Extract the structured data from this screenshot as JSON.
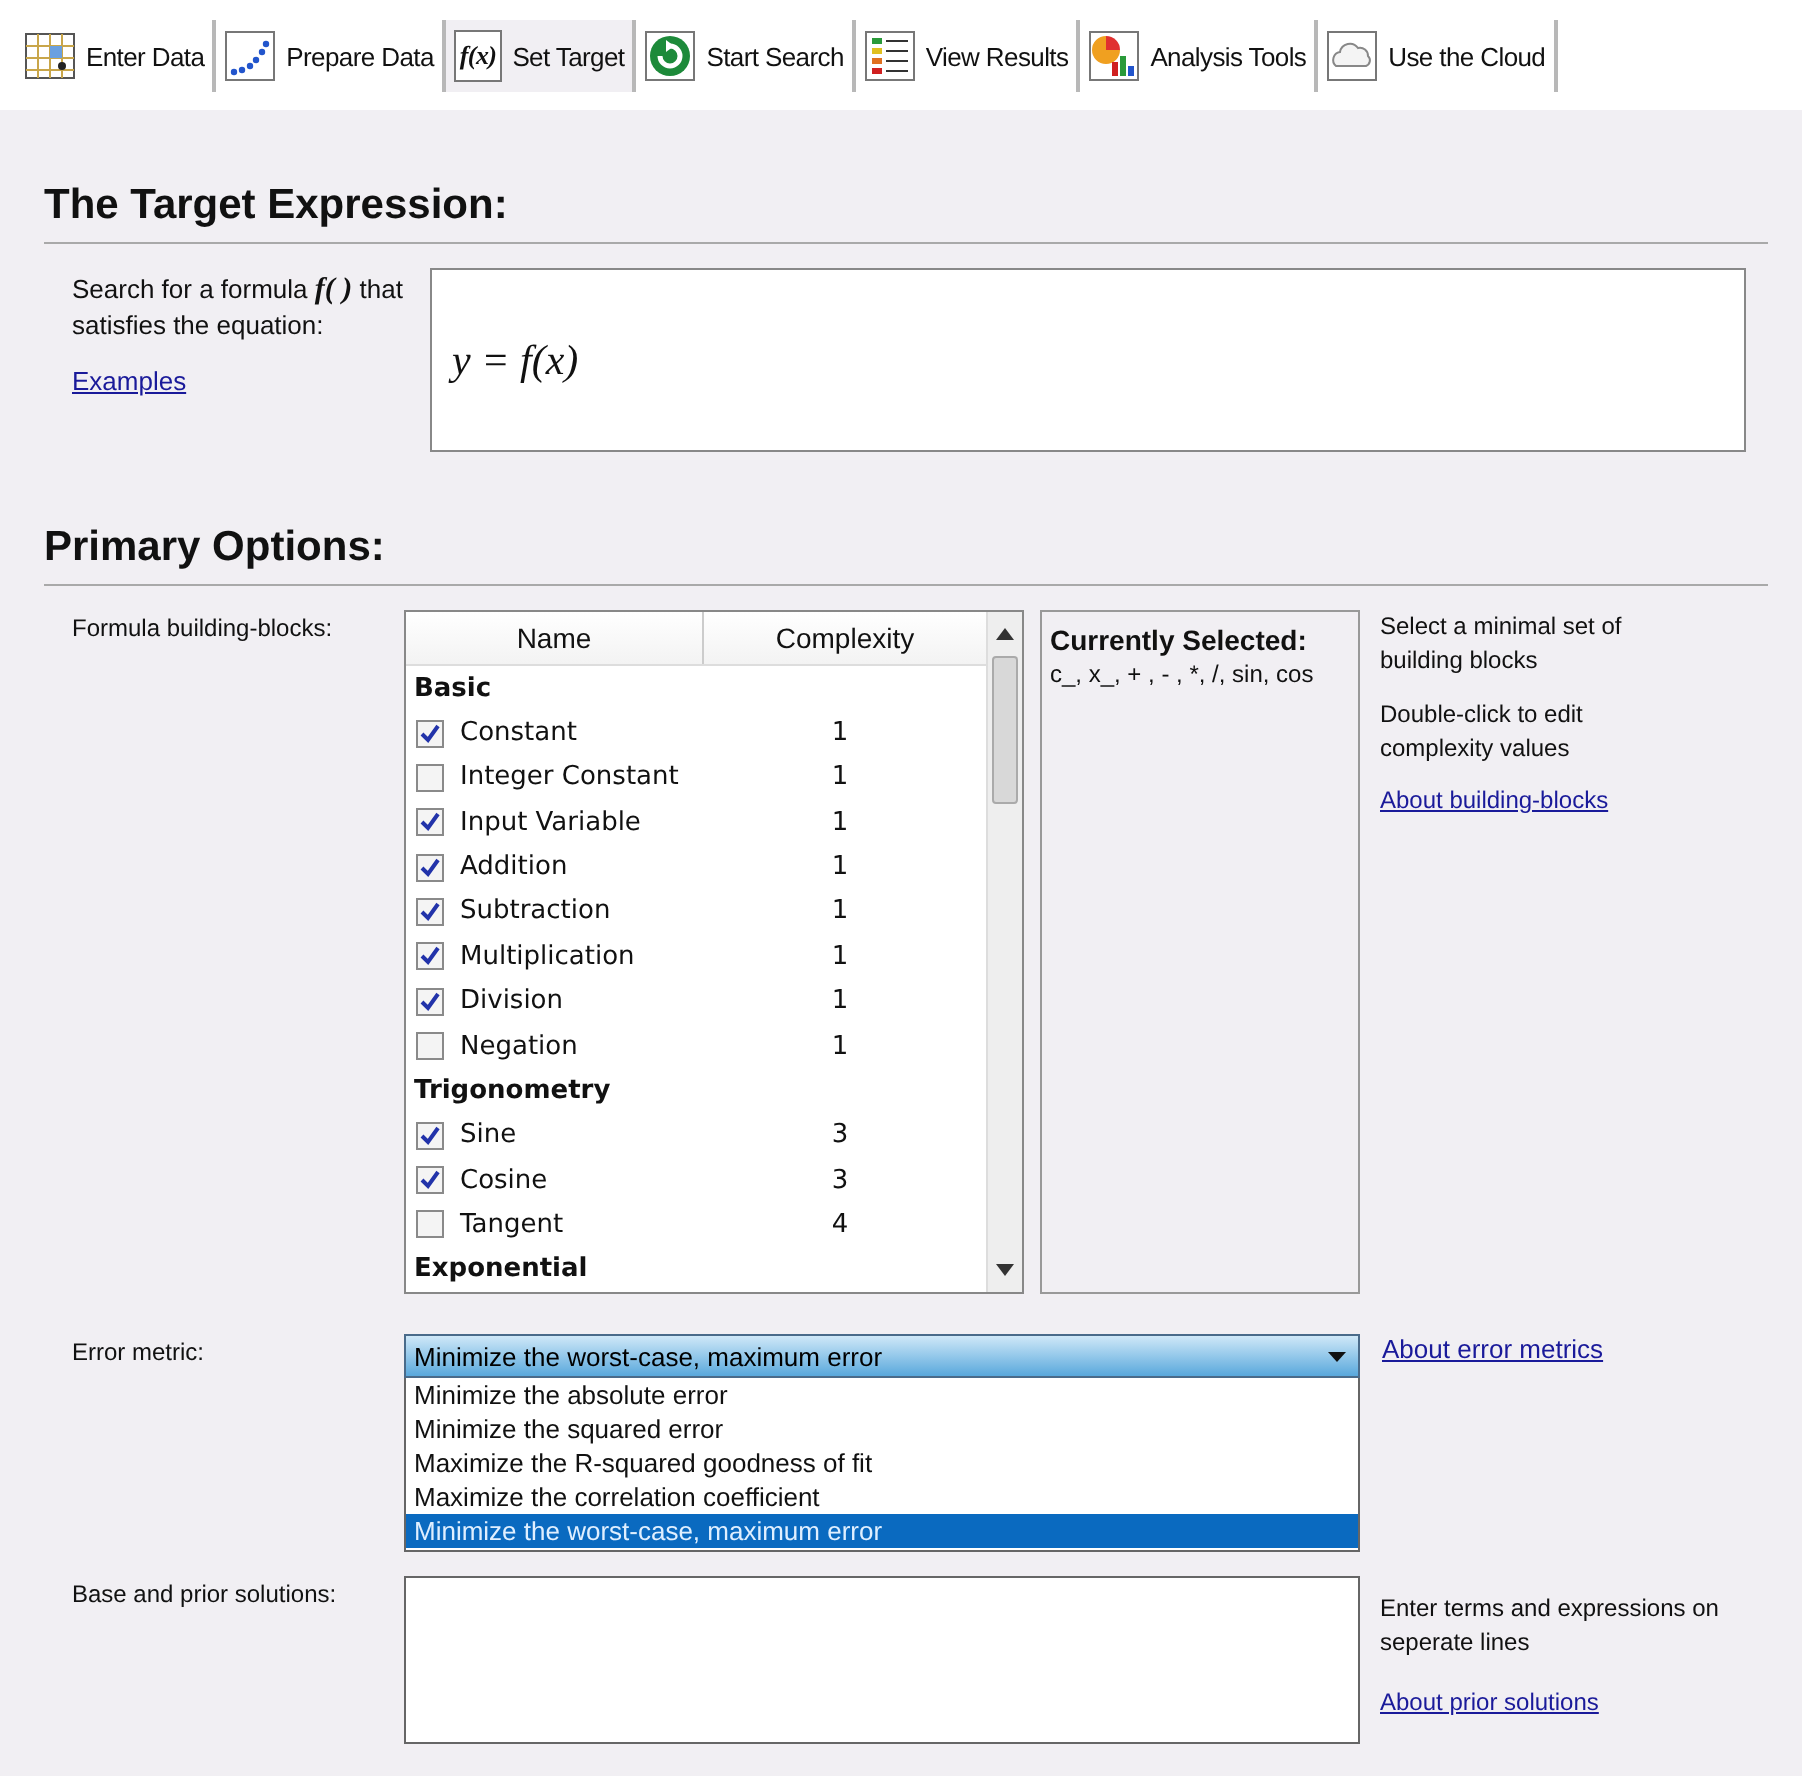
{
  "tabs": [
    {
      "label": "Enter Data",
      "selected": false
    },
    {
      "label": "Prepare Data",
      "selected": false
    },
    {
      "label": "Set Target",
      "icon_text": "f(x)",
      "selected": true
    },
    {
      "label": "Start Search",
      "selected": false
    },
    {
      "label": "View Results",
      "selected": false
    },
    {
      "label": "Analysis Tools",
      "selected": false
    },
    {
      "label": "Use the Cloud",
      "selected": false
    }
  ],
  "target": {
    "heading": "The Target Expression:",
    "label": "Search for a formula **f( )** that satisfies the equation:",
    "link": "Examples",
    "expression": "y = f(x)"
  },
  "options": {
    "heading": "Primary Options:",
    "building_blocks": {
      "label": "Formula building-blocks:",
      "columns": [
        "Name",
        "Complexity"
      ],
      "rows": [
        {
          "kind": "group",
          "name": "Basic"
        },
        {
          "kind": "item",
          "name": "Constant",
          "complexity": "1",
          "checked": true
        },
        {
          "kind": "item",
          "name": "Integer Constant",
          "complexity": "1",
          "checked": false
        },
        {
          "kind": "item",
          "name": "Input Variable",
          "complexity": "1",
          "checked": true
        },
        {
          "kind": "item",
          "name": "Addition",
          "complexity": "1",
          "checked": true
        },
        {
          "kind": "item",
          "name": "Subtraction",
          "complexity": "1",
          "checked": true
        },
        {
          "kind": "item",
          "name": "Multiplication",
          "complexity": "1",
          "checked": true
        },
        {
          "kind": "item",
          "name": "Division",
          "complexity": "1",
          "checked": true
        },
        {
          "kind": "item",
          "name": "Negation",
          "complexity": "1",
          "checked": false
        },
        {
          "kind": "group",
          "name": "Trigonometry"
        },
        {
          "kind": "item",
          "name": "Sine",
          "complexity": "3",
          "checked": true
        },
        {
          "kind": "item",
          "name": "Cosine",
          "complexity": "3",
          "checked": true
        },
        {
          "kind": "item",
          "name": "Tangent",
          "complexity": "4",
          "checked": false
        },
        {
          "kind": "group",
          "name": "Exponential"
        }
      ],
      "selected_title": "Currently Selected:",
      "selected_text": "c_, x_, + , - , *, /, sin, cos",
      "help": [
        "Select a minimal set of building blocks",
        "Double-click to edit complexity values"
      ],
      "help_link": "About building-blocks"
    },
    "error_metric": {
      "label": "Error metric:",
      "value": "Minimize the worst-case, maximum error",
      "link": "About error metrics",
      "options": [
        {
          "label": "Minimize the absolute error",
          "selected": false
        },
        {
          "label": "Minimize the squared error",
          "selected": false
        },
        {
          "label": "Maximize the R-squared goodness of fit",
          "selected": false
        },
        {
          "label": "Maximize the correlation coefficient",
          "selected": false
        },
        {
          "label": "Minimize the worst-case, maximum error",
          "selected": true
        }
      ]
    },
    "prior_solutions": {
      "label": "Base and prior solutions:",
      "help": "Enter terms and expressions on seperate lines",
      "link": "About prior solutions"
    }
  }
}
